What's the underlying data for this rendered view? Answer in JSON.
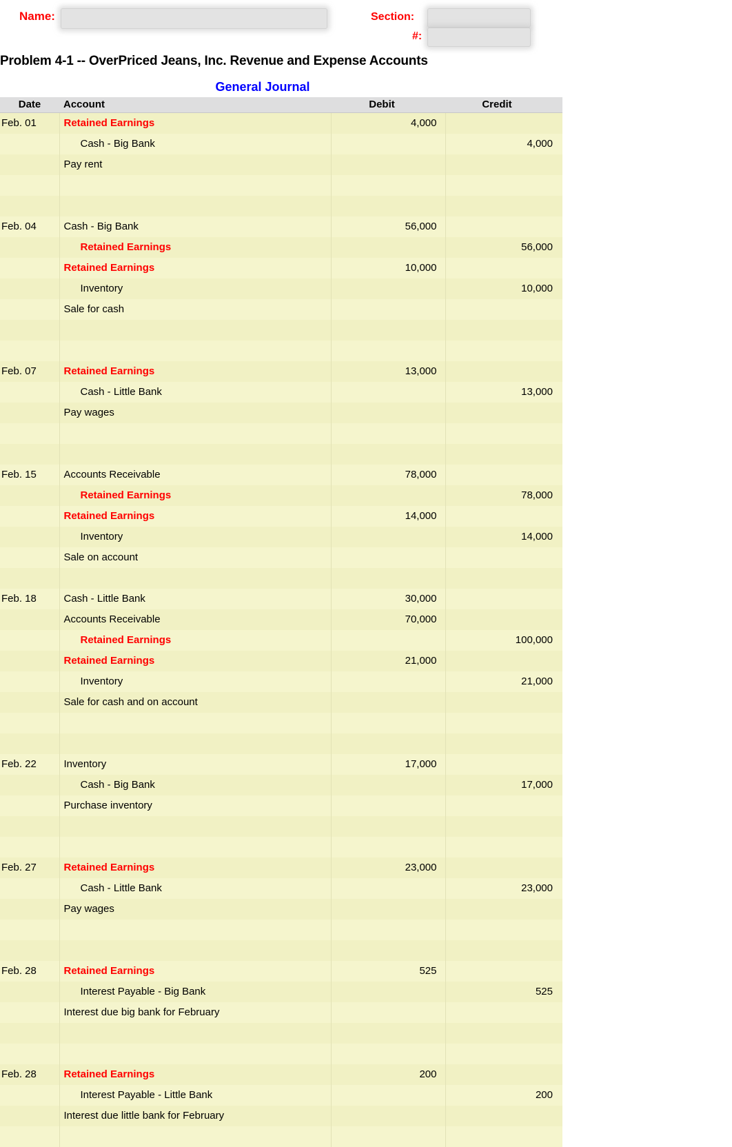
{
  "header": {
    "name_label": "Name:",
    "section_label": "Section:",
    "number_label": "#:",
    "name_value": "",
    "section_value": "",
    "number_value": ""
  },
  "titles": {
    "problem": "Problem 4-1 -- OverPriced Jeans, Inc. Revenue and Expense Accounts",
    "journal": "General Journal",
    "journal_color": "#0000ff"
  },
  "table": {
    "columns": [
      "Date",
      "Account",
      "Debit",
      "Credit"
    ],
    "colors": {
      "header_bg": "#dededf",
      "body_bg": "#f1f1c4",
      "body_bg_alt": "#f5f5cd",
      "account_highlight": "#ff0000",
      "text": "#000000"
    },
    "rows": [
      {
        "date": "Feb. 01",
        "account": "Retained Earnings",
        "indent": 0,
        "red": true,
        "debit": "4,000",
        "credit": ""
      },
      {
        "date": "",
        "account": "Cash - Big Bank",
        "indent": 1,
        "red": false,
        "debit": "",
        "credit": "4,000"
      },
      {
        "date": "",
        "account": "Pay rent",
        "indent": 0,
        "red": false,
        "debit": "",
        "credit": ""
      },
      {
        "date": "",
        "account": "",
        "indent": 0,
        "red": false,
        "debit": "",
        "credit": ""
      },
      {
        "date": "",
        "account": "",
        "indent": 0,
        "red": false,
        "debit": "",
        "credit": ""
      },
      {
        "date": "Feb. 04",
        "account": "Cash - Big Bank",
        "indent": 0,
        "red": false,
        "debit": "56,000",
        "credit": ""
      },
      {
        "date": "",
        "account": "Retained Earnings",
        "indent": 1,
        "red": true,
        "debit": "",
        "credit": "56,000"
      },
      {
        "date": "",
        "account": "Retained Earnings",
        "indent": 0,
        "red": true,
        "debit": "10,000",
        "credit": ""
      },
      {
        "date": "",
        "account": "Inventory",
        "indent": 1,
        "red": false,
        "debit": "",
        "credit": "10,000"
      },
      {
        "date": "",
        "account": "Sale for cash",
        "indent": 0,
        "red": false,
        "debit": "",
        "credit": ""
      },
      {
        "date": "",
        "account": "",
        "indent": 0,
        "red": false,
        "debit": "",
        "credit": ""
      },
      {
        "date": "",
        "account": "",
        "indent": 0,
        "red": false,
        "debit": "",
        "credit": ""
      },
      {
        "date": "Feb. 07",
        "account": "Retained Earnings",
        "indent": 0,
        "red": true,
        "debit": "13,000",
        "credit": ""
      },
      {
        "date": "",
        "account": "Cash - Little Bank",
        "indent": 1,
        "red": false,
        "debit": "",
        "credit": "13,000"
      },
      {
        "date": "",
        "account": "Pay wages",
        "indent": 0,
        "red": false,
        "debit": "",
        "credit": ""
      },
      {
        "date": "",
        "account": "",
        "indent": 0,
        "red": false,
        "debit": "",
        "credit": ""
      },
      {
        "date": "",
        "account": "",
        "indent": 0,
        "red": false,
        "debit": "",
        "credit": ""
      },
      {
        "date": "Feb. 15",
        "account": "Accounts Receivable",
        "indent": 0,
        "red": false,
        "debit": "78,000",
        "credit": ""
      },
      {
        "date": "",
        "account": "Retained Earnings",
        "indent": 1,
        "red": true,
        "debit": "",
        "credit": "78,000"
      },
      {
        "date": "",
        "account": "Retained Earnings",
        "indent": 0,
        "red": true,
        "debit": "14,000",
        "credit": ""
      },
      {
        "date": "",
        "account": "Inventory",
        "indent": 1,
        "red": false,
        "debit": "",
        "credit": "14,000"
      },
      {
        "date": "",
        "account": "Sale on account",
        "indent": 0,
        "red": false,
        "debit": "",
        "credit": ""
      },
      {
        "date": "",
        "account": "",
        "indent": 0,
        "red": false,
        "debit": "",
        "credit": ""
      },
      {
        "date": "Feb. 18",
        "account": "Cash - Little Bank",
        "indent": 0,
        "red": false,
        "debit": "30,000",
        "credit": ""
      },
      {
        "date": "",
        "account": "Accounts Receivable",
        "indent": 0,
        "red": false,
        "debit": "70,000",
        "credit": ""
      },
      {
        "date": "",
        "account": "Retained Earnings",
        "indent": 1,
        "red": true,
        "debit": "",
        "credit": "100,000"
      },
      {
        "date": "",
        "account": "Retained Earnings",
        "indent": 0,
        "red": true,
        "debit": "21,000",
        "credit": ""
      },
      {
        "date": "",
        "account": "Inventory",
        "indent": 1,
        "red": false,
        "debit": "",
        "credit": "21,000"
      },
      {
        "date": "",
        "account": "Sale for cash and on account",
        "indent": 0,
        "red": false,
        "debit": "",
        "credit": ""
      },
      {
        "date": "",
        "account": "",
        "indent": 0,
        "red": false,
        "debit": "",
        "credit": ""
      },
      {
        "date": "",
        "account": "",
        "indent": 0,
        "red": false,
        "debit": "",
        "credit": ""
      },
      {
        "date": "Feb. 22",
        "account": "Inventory",
        "indent": 0,
        "red": false,
        "debit": "17,000",
        "credit": ""
      },
      {
        "date": "",
        "account": "Cash - Big Bank",
        "indent": 1,
        "red": false,
        "debit": "",
        "credit": "17,000"
      },
      {
        "date": "",
        "account": "Purchase inventory",
        "indent": 0,
        "red": false,
        "debit": "",
        "credit": ""
      },
      {
        "date": "",
        "account": "",
        "indent": 0,
        "red": false,
        "debit": "",
        "credit": ""
      },
      {
        "date": "",
        "account": "",
        "indent": 0,
        "red": false,
        "debit": "",
        "credit": ""
      },
      {
        "date": "Feb. 27",
        "account": "Retained Earnings",
        "indent": 0,
        "red": true,
        "debit": "23,000",
        "credit": ""
      },
      {
        "date": "",
        "account": "Cash - Little Bank",
        "indent": 1,
        "red": false,
        "debit": "",
        "credit": "23,000"
      },
      {
        "date": "",
        "account": "Pay wages",
        "indent": 0,
        "red": false,
        "debit": "",
        "credit": ""
      },
      {
        "date": "",
        "account": "",
        "indent": 0,
        "red": false,
        "debit": "",
        "credit": ""
      },
      {
        "date": "",
        "account": "",
        "indent": 0,
        "red": false,
        "debit": "",
        "credit": ""
      },
      {
        "date": "Feb. 28",
        "account": "Retained Earnings",
        "indent": 0,
        "red": true,
        "debit": "525",
        "credit": ""
      },
      {
        "date": "",
        "account": "Interest Payable - Big Bank",
        "indent": 1,
        "red": false,
        "debit": "",
        "credit": "525"
      },
      {
        "date": "",
        "account": "Interest due big bank for February",
        "indent": 0,
        "red": false,
        "debit": "",
        "credit": ""
      },
      {
        "date": "",
        "account": "",
        "indent": 0,
        "red": false,
        "debit": "",
        "credit": ""
      },
      {
        "date": "",
        "account": "",
        "indent": 0,
        "red": false,
        "debit": "",
        "credit": ""
      },
      {
        "date": "Feb. 28",
        "account": "Retained Earnings",
        "indent": 0,
        "red": true,
        "debit": "200",
        "credit": ""
      },
      {
        "date": "",
        "account": "Interest Payable - Little Bank",
        "indent": 1,
        "red": false,
        "debit": "",
        "credit": "200"
      },
      {
        "date": "",
        "account": "Interest due little bank for February",
        "indent": 0,
        "red": false,
        "debit": "",
        "credit": ""
      },
      {
        "date": "",
        "account": "",
        "indent": 0,
        "red": false,
        "debit": "",
        "credit": ""
      }
    ]
  }
}
